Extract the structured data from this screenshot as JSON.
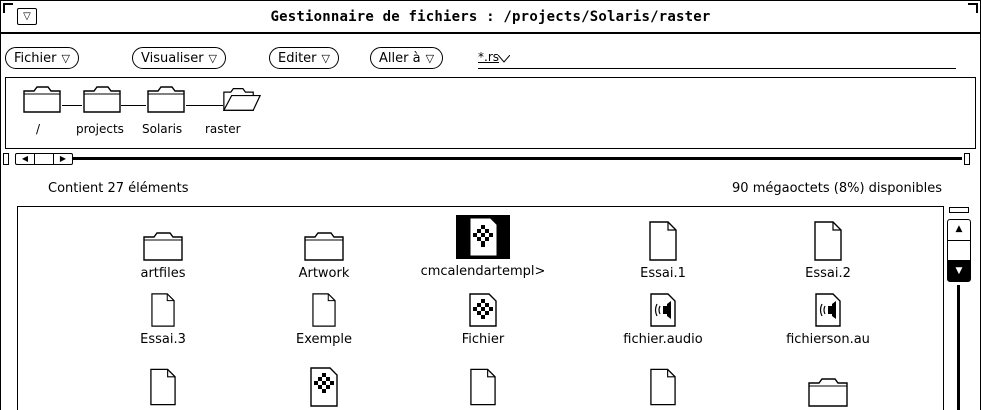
{
  "window": {
    "title": "Gestionnaire de fichiers : /projects/Solaris/raster",
    "menu_glyph": "▽"
  },
  "menubar": {
    "items": [
      {
        "label": "Fichier",
        "glyph": "▽"
      },
      {
        "label": "Visualiser",
        "glyph": "▽"
      },
      {
        "label": "Editer",
        "glyph": "▽"
      },
      {
        "label": "Aller à",
        "glyph": "▽"
      }
    ],
    "filter": {
      "value": "*.rs"
    }
  },
  "path": {
    "items": [
      {
        "label": "/",
        "icon": "folder-icon"
      },
      {
        "label": "projects",
        "icon": "folder-icon"
      },
      {
        "label": "Solaris",
        "icon": "folder-icon"
      },
      {
        "label": "raster",
        "icon": "open-folder-icon"
      }
    ]
  },
  "status": {
    "count": "Contient 27 éléments",
    "space": "90 mégaoctets (8%) disponibles"
  },
  "files": [
    {
      "label": "artfiles",
      "icon": "folder-icon"
    },
    {
      "label": "Artwork",
      "icon": "folder-icon"
    },
    {
      "label": "cmcalendartempl>",
      "icon": "app-document-icon",
      "selected": true
    },
    {
      "label": "Essai.1",
      "icon": "document-icon"
    },
    {
      "label": "Essai.2",
      "icon": "document-icon"
    },
    {
      "label": "Essai.3",
      "icon": "document-icon"
    },
    {
      "label": "Exemple",
      "icon": "document-icon"
    },
    {
      "label": "Fichier",
      "icon": "app-document-icon"
    },
    {
      "label": "fichier.audio",
      "icon": "audio-file-icon"
    },
    {
      "label": "fichierson.au",
      "icon": "audio-file-icon"
    },
    {
      "label": "",
      "icon": "document-icon"
    },
    {
      "label": "",
      "icon": "app-document-icon"
    },
    {
      "label": "",
      "icon": "document-icon"
    },
    {
      "label": "",
      "icon": "document-icon"
    },
    {
      "label": "",
      "icon": "folder-icon"
    }
  ]
}
